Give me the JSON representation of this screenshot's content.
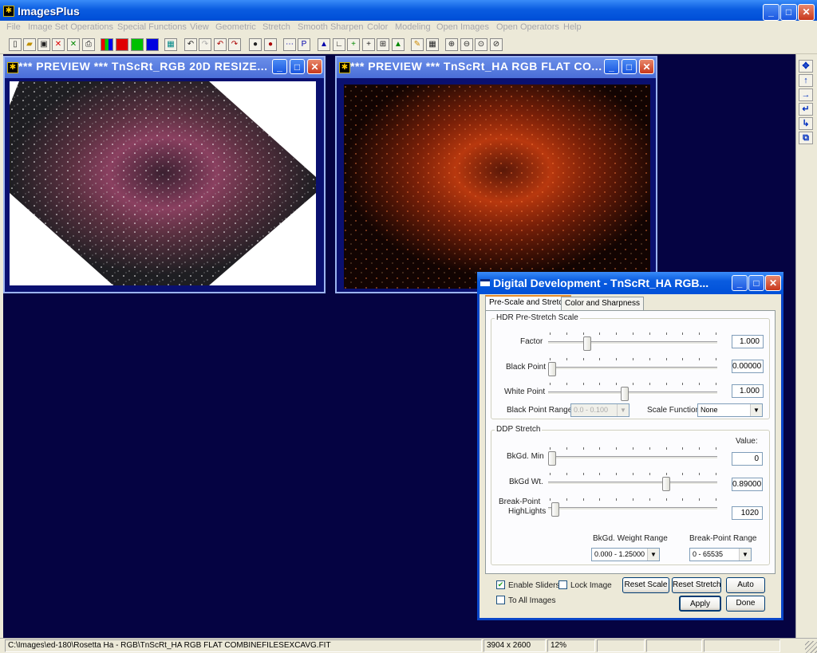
{
  "app": {
    "title": "ImagesPlus",
    "icon": "app-logo-icon"
  },
  "menu": [
    "File",
    "Image Set Operations",
    "Special Functions",
    "View",
    "Geometric",
    "Stretch",
    "Smooth Sharpen",
    "Color",
    "Modeling",
    "Open Images",
    "Open Operators",
    "Help"
  ],
  "window_controls": {
    "minimize": "_",
    "maximize": "□",
    "close": "✕"
  },
  "toolbar": {
    "color_buttons": {
      "red": "#e00000",
      "green": "#00c000",
      "blue": "#0000e0"
    }
  },
  "child1": {
    "title": "*** PREVIEW *** TnScRt_RGB 20D RESIZE..."
  },
  "child2": {
    "title": "*** PREVIEW *** TnScRt_HA RGB FLAT CO..."
  },
  "dialog": {
    "title": "Digital Development - TnScRt_HA RGB...",
    "tabs": [
      "Pre-Scale and Stretch",
      "Color and Sharpness"
    ],
    "hdr": {
      "title": "HDR Pre-Stretch Scale",
      "factor_label": "Factor",
      "factor_value": "1.000",
      "factor_level": 0.22,
      "black_label": "Black Point",
      "black_value": "0.00000",
      "black_level": 0.0,
      "white_label": "White Point",
      "white_value": "1.000",
      "white_level": 0.45,
      "bp_range_label": "Black Point Range",
      "bp_range_value": "0.0 - 0.100",
      "scale_fn_label": "Scale Function",
      "scale_fn_value": "None"
    },
    "ddp": {
      "title": "DDP Stretch",
      "value_header": "Value:",
      "bkgd_min_label": "BkGd. Min",
      "bkgd_min_value": "0",
      "bkgd_min_level": 0.0,
      "bkgd_wt_label": "BkGd Wt.",
      "bkgd_wt_value": "0.89000",
      "bkgd_wt_level": 0.71,
      "bp_label_1": "Break-Point",
      "bp_label_2": "HighLights",
      "bp_value": "1020",
      "bp_level": 0.02,
      "weight_range_label": "BkGd. Weight Range",
      "weight_range_value": "0.000 - 1.25000",
      "bp_range_label": "Break-Point Range",
      "bp_range_value": "0 - 65535"
    },
    "enable_sliders": {
      "label": "Enable Sliders",
      "checked": true
    },
    "lock_image": {
      "label": "Lock Image",
      "checked": false
    },
    "to_all": {
      "label": "To All Images",
      "checked": false
    },
    "buttons": {
      "reset_scale": "Reset Scale",
      "reset_stretch": "Reset Stretch",
      "auto": "Auto",
      "apply": "Apply",
      "done": "Done"
    }
  },
  "status": {
    "path": "C:\\Images\\ed-180\\Rosetta Ha - RGB\\TnScRt_HA RGB FLAT COMBINEFILESEXCAVG.FIT",
    "dims": "3904 x 2600",
    "zoom": "12%"
  },
  "sidebar_icons": [
    "move-icon",
    "arrow-up-icon",
    "arrow-right-icon",
    "rotate-left-icon",
    "rotate-right-icon",
    "copy-icon"
  ]
}
